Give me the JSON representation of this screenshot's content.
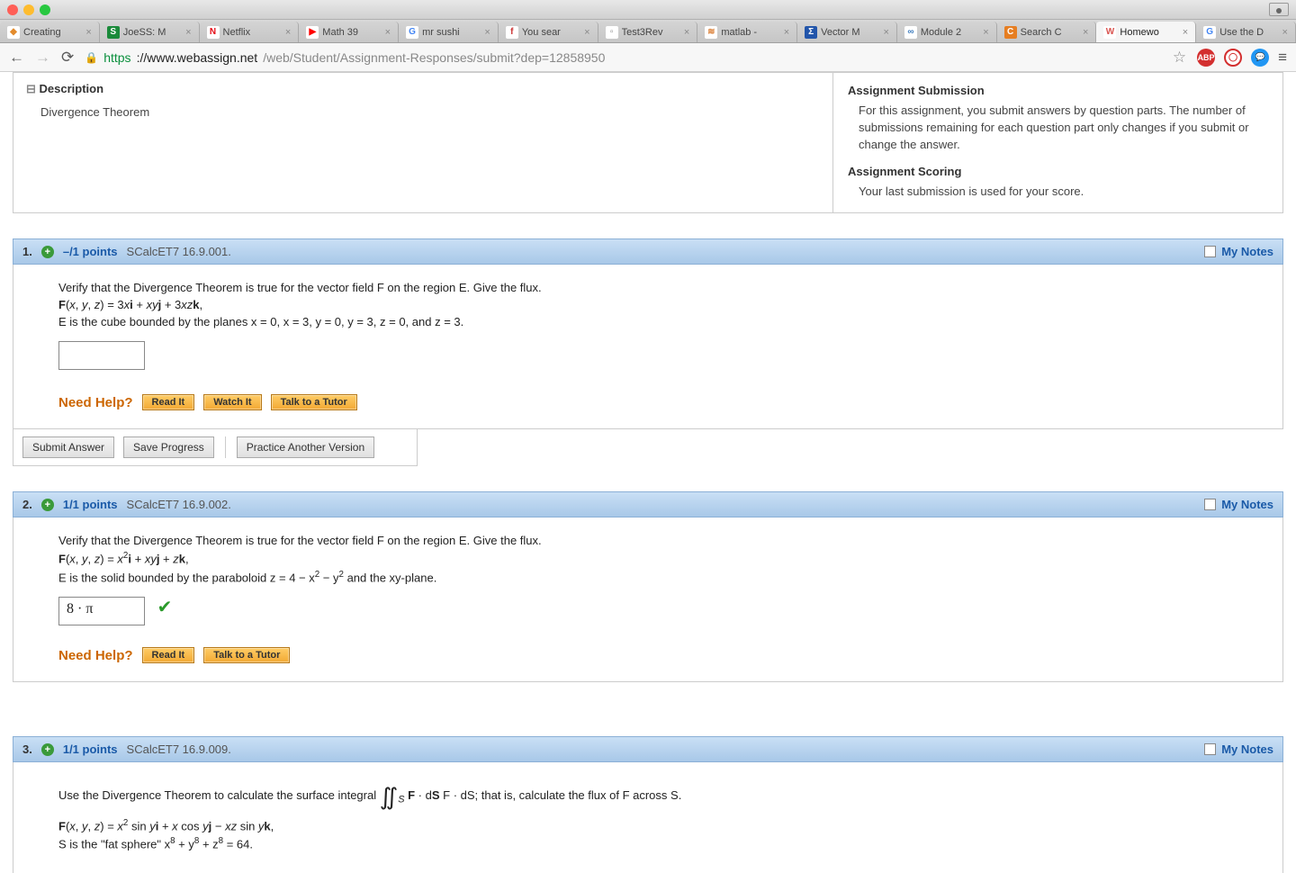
{
  "browser": {
    "tabs": [
      {
        "label": "Creating",
        "favbg": "#fff",
        "favcolor": "#e38b2c",
        "favchar": "◆"
      },
      {
        "label": "JoeSS: M",
        "favbg": "#1a8a3a",
        "favcolor": "#fff",
        "favchar": "S"
      },
      {
        "label": "Netflix",
        "favbg": "#fff",
        "favcolor": "#e50914",
        "favchar": "N"
      },
      {
        "label": "Math 39",
        "favbg": "#fff",
        "favcolor": "#f00",
        "favchar": "▶"
      },
      {
        "label": "mr sushi",
        "favbg": "#fff",
        "favcolor": "#4285f4",
        "favchar": "G"
      },
      {
        "label": "You sear",
        "favbg": "#fff",
        "favcolor": "#c33",
        "favchar": "f"
      },
      {
        "label": "Test3Rev",
        "favbg": "#fff",
        "favcolor": "#888",
        "favchar": "▫"
      },
      {
        "label": "matlab -",
        "favbg": "#fff",
        "favcolor": "#d97a2e",
        "favchar": "≋"
      },
      {
        "label": "Vector M",
        "favbg": "#2255aa",
        "favcolor": "#fff",
        "favchar": "Σ"
      },
      {
        "label": "Module 2",
        "favbg": "#fff",
        "favcolor": "#3a7abd",
        "favchar": "∞"
      },
      {
        "label": "Search C",
        "favbg": "#e67e22",
        "favcolor": "#fff",
        "favchar": "C"
      },
      {
        "label": "Homewo",
        "favbg": "#fff",
        "favcolor": "#d9534f",
        "favchar": "W",
        "active": true
      },
      {
        "label": "Use the D",
        "favbg": "#fff",
        "favcolor": "#4285f4",
        "favchar": "G"
      }
    ],
    "url": {
      "proto": "https",
      "host": "://www.webassign.net",
      "path": "/web/Student/Assignment-Responses/submit?dep=12858950"
    }
  },
  "desc": {
    "heading": "Description",
    "body": "Divergence Theorem"
  },
  "side": {
    "h1": "Assignment Submission",
    "p1": "For this assignment, you submit answers by question parts. The number of submissions remaining for each question part only changes if you submit or change the answer.",
    "h2": "Assignment Scoring",
    "p2": "Your last submission is used for your score."
  },
  "notes_label": "My Notes",
  "help_label": "Need Help?",
  "btn": {
    "read": "Read It",
    "watch": "Watch It",
    "tutor": "Talk to a Tutor",
    "submit": "Submit Answer",
    "save": "Save Progress",
    "practice": "Practice Another Version"
  },
  "q1": {
    "num": "1.",
    "pts": "–/1 points",
    "src": "SCalcET7 16.9.001.",
    "prompt": "Verify that the Divergence Theorem is true for the vector field F on the region E. Give the flux.",
    "field": "F(x, y, z) = 3xi + xyj + 3xzk,",
    "region": "E is the cube bounded by the planes x = 0, x = 3, y = 0, y = 3, z = 0, and z = 3."
  },
  "q2": {
    "num": "2.",
    "pts": "1/1 points",
    "src": "SCalcET7 16.9.002.",
    "prompt": "Verify that the Divergence Theorem is true for the vector field F on the region E. Give the flux.",
    "field_a": "F(x, y, z) = x",
    "field_b": "i + xyj + zk,",
    "region_a": "E is the solid bounded by the paraboloid  z = 4 − x",
    "region_b": " − y",
    "region_c": "  and the xy-plane.",
    "answer": "8 · π"
  },
  "q3": {
    "num": "3.",
    "pts": "1/1 points",
    "src": "SCalcET7 16.9.009.",
    "prompt_a": "Use the Divergence Theorem to calculate the surface integral ",
    "prompt_b": " F · dS;  that is, calculate the flux of F across S.",
    "field_a": "F(x, y, z) = x",
    "field_b": " sin yi + x cos yj − xz sin yk,",
    "region_a": "S is the \"fat sphere\"  x",
    "region_b": " + y",
    "region_c": " + z",
    "region_d": " = 64."
  }
}
